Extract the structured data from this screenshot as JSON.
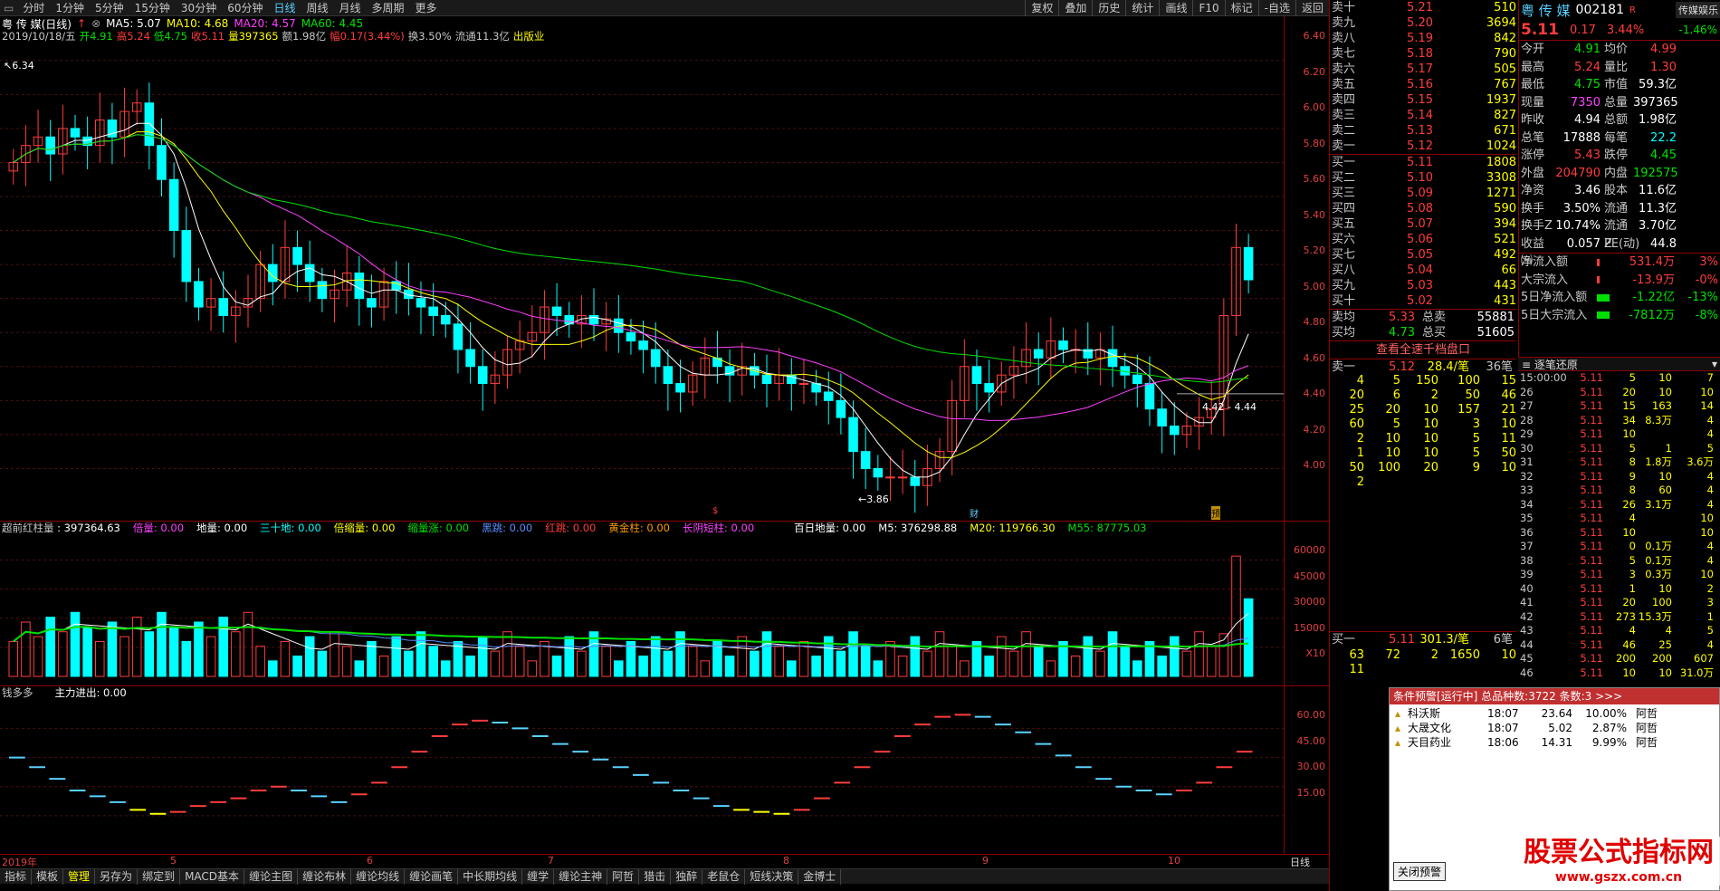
{
  "toolbar": {
    "periods": [
      "分时",
      "1分钟",
      "5分钟",
      "15分钟",
      "30分钟",
      "60分钟",
      "日线",
      "周线",
      "月线",
      "多周期",
      "更多"
    ],
    "active_period": "日线",
    "tools": [
      "复权",
      "叠加",
      "历史",
      "统计",
      "画线",
      "F10",
      "标记",
      "-自选",
      "返回"
    ]
  },
  "header": {
    "stock_name": "粤 传 媒(日线)",
    "ma5": "MA5: 5.07",
    "ma10": "MA10: 4.68",
    "ma20": "MA20: 4.57",
    "ma60": "MA60: 4.45",
    "date": "2019/10/18/五",
    "open": "开4.91",
    "high": "高5.24",
    "low": "低4.75",
    "close": "收5.11",
    "volume": "量397365",
    "amount": "额1.98亿",
    "change": "幅0.17(3.44%)",
    "turnover": "换3.50%",
    "float": "流通11.3亿",
    "industry": "出版业",
    "high_mark": "6.34",
    "low_mark": "3.86",
    "cross_mark": "4.42 - 4.44",
    "markers": [
      "$",
      "财",
      "预"
    ]
  },
  "price_axis": [
    "6.40",
    "6.20",
    "6.00",
    "5.80",
    "5.60",
    "5.40",
    "5.20",
    "5.00",
    "4.80",
    "4.60",
    "4.40",
    "4.20",
    "4.00"
  ],
  "volume_header": {
    "name": "超前红柱量",
    "value": ": 397364.63",
    "items": [
      "倍量: 0.00",
      "地量: 0.00",
      "三十地: 0.00",
      "倍缩量: 0.00",
      "缩量涨: 0.00",
      "黑跳: 0.00",
      "红跳: 0.00",
      "黄金柱: 0.00",
      "长阴短柱: 0.00"
    ],
    "baitian": "百日地量: 0.00",
    "m5": "M5: 376298.88",
    "m20": "M20: 119766.30",
    "m55": "M55: 87775.03"
  },
  "volume_axis": [
    "60000",
    "45000",
    "30000",
    "15000",
    "X10"
  ],
  "indicator_header": {
    "name": "钱多多",
    "value": "主力进出: 0.00"
  },
  "indicator_axis": [
    "60.00",
    "45.00",
    "30.00",
    "15.00"
  ],
  "date_axis": [
    "2019年",
    "5",
    "6",
    "7",
    "8",
    "9",
    "10",
    "日线"
  ],
  "tabs": [
    "指标",
    "模板",
    "管理",
    "另存为",
    "绑定到",
    "MACD基本",
    "缠论主图",
    "缠论布林",
    "缠论均线",
    "缠论画笔",
    "中长期均线",
    "缠学",
    "缠论主神",
    "阿哲",
    "猎击",
    "独醉",
    "老鼠仓",
    "短线决策",
    "金博士"
  ],
  "active_tab": "管理",
  "quote": {
    "title": "粤 传 媒",
    "code": "002181",
    "r_mark": "R",
    "logo": "传媒娱乐",
    "last": "5.11",
    "chg": "0.17",
    "pct": "3.44%",
    "logo_pct": "-1.46%",
    "sells": [
      {
        "n": "卖十",
        "p": "5.21",
        "v": "510"
      },
      {
        "n": "卖九",
        "p": "5.20",
        "v": "3694"
      },
      {
        "n": "卖八",
        "p": "5.19",
        "v": "842"
      },
      {
        "n": "卖七",
        "p": "5.18",
        "v": "790"
      },
      {
        "n": "卖六",
        "p": "5.17",
        "v": "505"
      },
      {
        "n": "卖五",
        "p": "5.16",
        "v": "767"
      },
      {
        "n": "卖四",
        "p": "5.15",
        "v": "1937"
      },
      {
        "n": "卖三",
        "p": "5.14",
        "v": "827"
      },
      {
        "n": "卖二",
        "p": "5.13",
        "v": "671"
      },
      {
        "n": "卖一",
        "p": "5.12",
        "v": "1024"
      }
    ],
    "buys": [
      {
        "n": "买一",
        "p": "5.11",
        "v": "1808"
      },
      {
        "n": "买二",
        "p": "5.10",
        "v": "3308"
      },
      {
        "n": "买三",
        "p": "5.09",
        "v": "1271"
      },
      {
        "n": "买四",
        "p": "5.08",
        "v": "590"
      },
      {
        "n": "买五",
        "p": "5.07",
        "v": "394"
      },
      {
        "n": "买六",
        "p": "5.06",
        "v": "521"
      },
      {
        "n": "买七",
        "p": "5.05",
        "v": "492"
      },
      {
        "n": "买八",
        "p": "5.04",
        "v": "66"
      },
      {
        "n": "买九",
        "p": "5.03",
        "v": "443"
      },
      {
        "n": "买十",
        "p": "5.02",
        "v": "431"
      }
    ],
    "avg_sell": {
      "k": "卖均",
      "v": "5.33",
      "k2": "总卖",
      "v2": "55881"
    },
    "avg_buy": {
      "k": "买均",
      "v": "4.73",
      "k2": "总买",
      "v2": "51605"
    },
    "depth_button": "查看全速千档盘口",
    "depth_sell1": {
      "k": "卖一",
      "p": "5.12",
      "avg": "28.4/笔",
      "n": "36笔"
    },
    "depth_sell_grid": [
      "4",
      "5",
      "150",
      "100",
      "15",
      "20",
      "6",
      "2",
      "50",
      "46",
      "25",
      "20",
      "10",
      "157",
      "21",
      "60",
      "5",
      "10",
      "3",
      "10",
      "2",
      "10",
      "10",
      "5",
      "11",
      "1",
      "10",
      "10",
      "5",
      "50",
      "50",
      "100",
      "20",
      "9",
      "10",
      "2"
    ],
    "depth_buy1": {
      "k": "买一",
      "p": "5.11",
      "avg": "301.3/笔",
      "n": "6笔"
    },
    "depth_buy_grid": [
      "63",
      "72",
      "2",
      "1650",
      "10",
      "11"
    ]
  },
  "stats": [
    {
      "k": "今开",
      "a": "4.91",
      "k2": "均价",
      "b": "4.99"
    },
    {
      "k": "最高",
      "a": "5.24",
      "k2": "量比",
      "b": "1.30"
    },
    {
      "k": "最低",
      "a": "4.75",
      "k2": "市值",
      "b": "59.3亿"
    },
    {
      "k": "现量",
      "a": "7350",
      "k2": "总量",
      "b": "397365"
    },
    {
      "k": "昨收",
      "a": "4.94",
      "k2": "总额",
      "b": "1.98亿"
    },
    {
      "k": "总笔",
      "a": "17888",
      "k2": "每笔",
      "b": "22.2"
    },
    {
      "k": "涨停",
      "a": "5.43",
      "k2": "跌停",
      "b": "4.45"
    },
    {
      "k": "外盘",
      "a": "204790",
      "k2": "内盘",
      "b": "192575"
    },
    {
      "k": "净资",
      "a": "3.46",
      "k2": "股本",
      "b": "11.6亿"
    },
    {
      "k": "换手",
      "a": "3.50%",
      "k2": "流通",
      "b": "11.3亿"
    },
    {
      "k": "换手Z",
      "a": "10.74%",
      "k2": "流通Z",
      "b": "3.70亿"
    },
    {
      "k": "收益㈢",
      "a": "0.057",
      "k2": "PE(动)",
      "b": "44.8"
    }
  ],
  "flows": [
    {
      "k": "净流入额",
      "v": "531.4万",
      "p": "3%"
    },
    {
      "k": "大宗流入",
      "v": "-13.9万",
      "p": "-0%"
    },
    {
      "k": "5日净流入额",
      "v": "-1.22亿",
      "p": "-13%"
    },
    {
      "k": "5日大宗流入",
      "v": "-7812万",
      "p": "-8%"
    }
  ],
  "ticks_title": "逐笔还原",
  "ticks": [
    {
      "t": "15:00:00",
      "p": "5.11",
      "v": "5",
      "x": "10"
    },
    {
      "t": "26",
      "p": "5.11",
      "v": "20",
      "x": "10"
    },
    {
      "t": "27",
      "p": "5.11",
      "v": "15",
      "x": "163"
    },
    {
      "t": "28",
      "p": "5.11",
      "v": "34",
      "x": "8.3万"
    },
    {
      "t": "29",
      "p": "5.11",
      "v": "10",
      "x": ""
    },
    {
      "t": "30",
      "p": "5.11",
      "v": "5",
      "x": "1"
    },
    {
      "t": "31",
      "p": "5.11",
      "v": "8",
      "x": "1.8万"
    },
    {
      "t": "32",
      "p": "5.11",
      "v": "9",
      "x": "10"
    },
    {
      "t": "33",
      "p": "5.11",
      "v": "8",
      "x": "60"
    },
    {
      "t": "34",
      "p": "5.11",
      "v": "26",
      "x": "3.1万"
    },
    {
      "t": "35",
      "p": "5.11",
      "v": "4",
      "x": ""
    },
    {
      "t": "36",
      "p": "5.11",
      "v": "10",
      "x": ""
    },
    {
      "t": "37",
      "p": "5.11",
      "v": "0",
      "x": "0.1万"
    },
    {
      "t": "38",
      "p": "5.11",
      "v": "5",
      "x": "0.1万"
    },
    {
      "t": "39",
      "p": "5.11",
      "v": "3",
      "x": "0.3万"
    },
    {
      "t": "40",
      "p": "5.11",
      "v": "1",
      "x": "10"
    },
    {
      "t": "41",
      "p": "5.11",
      "v": "20",
      "x": "100"
    },
    {
      "t": "42",
      "p": "5.11",
      "v": "273",
      "x": "15.3万"
    },
    {
      "t": "43",
      "p": "5.11",
      "v": "4",
      "x": "4"
    },
    {
      "t": "44",
      "p": "5.11",
      "v": "46",
      "x": "25"
    },
    {
      "t": "45",
      "p": "5.11",
      "v": "200",
      "x": "200"
    },
    {
      "t": "46",
      "p": "5.11",
      "v": "10",
      "x": "10"
    }
  ],
  "ticks_side": [
    "7",
    "10",
    "14",
    "4",
    "4",
    "5",
    "3.6万",
    "4",
    "4",
    "4",
    "10",
    "10",
    "4",
    "4",
    "10",
    "2",
    "3",
    "1",
    "5",
    "4",
    "607",
    "31.0万"
  ],
  "alert": {
    "title": "条件预警[运行中] 总品种数:3722 条数:3 >>>",
    "items": [
      {
        "name": "科沃斯",
        "time": "18:07",
        "price": "23.64",
        "pct": "10.00%",
        "tag": "阿哲"
      },
      {
        "name": "大晟文化",
        "time": "18:07",
        "price": "5.02",
        "pct": "2.87%",
        "tag": "阿哲"
      },
      {
        "name": "天目药业",
        "time": "18:06",
        "price": "14.31",
        "pct": "9.99%",
        "tag": "阿哲"
      }
    ],
    "close_button": "关闭预警"
  },
  "watermark": {
    "cn": "股票公式指标网",
    "url": "www.gszx.com.cn"
  },
  "colors": {
    "up": "#ff3c3c",
    "down": "#00ffff",
    "ma5": "#ffffff",
    "ma10": "#ffff00",
    "ma20": "#ff40ff",
    "ma60": "#00e000"
  },
  "chart_data": {
    "type": "candlestick",
    "ylim": [
      3.8,
      6.5
    ],
    "closes": [
      5.8,
      5.9,
      5.95,
      5.85,
      6.0,
      5.95,
      5.9,
      6.05,
      5.95,
      6.1,
      6.15,
      5.9,
      5.7,
      5.4,
      5.1,
      4.95,
      5.0,
      4.9,
      4.95,
      5.0,
      5.2,
      5.1,
      5.3,
      5.2,
      5.1,
      5.0,
      5.05,
      5.15,
      5.0,
      4.95,
      5.1,
      5.05,
      5.0,
      4.95,
      4.9,
      4.85,
      4.7,
      4.6,
      4.5,
      4.55,
      4.7,
      4.75,
      4.8,
      4.95,
      4.9,
      4.85,
      4.9,
      4.85,
      4.88,
      4.8,
      4.75,
      4.7,
      4.6,
      4.5,
      4.45,
      4.55,
      4.65,
      4.6,
      4.55,
      4.6,
      4.55,
      4.5,
      4.55,
      4.5,
      4.5,
      4.45,
      4.4,
      4.3,
      4.1,
      4.0,
      3.95,
      3.95,
      3.95,
      3.9,
      4.0,
      4.1,
      4.4,
      4.6,
      4.5,
      4.45,
      4.55,
      4.6,
      4.7,
      4.65,
      4.75,
      4.7,
      4.7,
      4.65,
      4.7,
      4.6,
      4.55,
      4.5,
      4.35,
      4.25,
      4.2,
      4.25,
      4.3,
      4.35,
      4.9,
      5.3,
      5.11
    ],
    "volume_ylim": [
      0,
      70000
    ]
  }
}
